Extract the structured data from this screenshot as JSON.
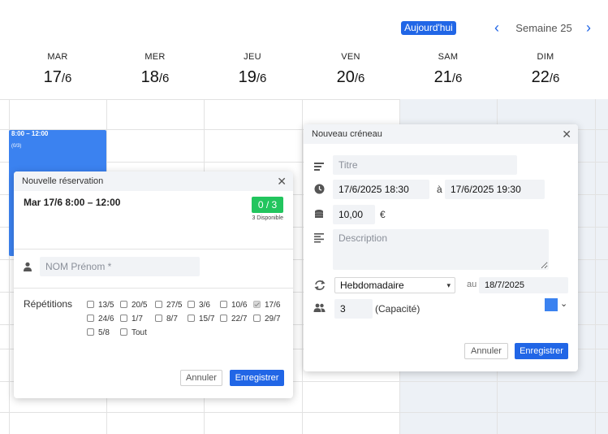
{
  "toolbar": {
    "today_label": "Aujourd'hui",
    "week_label": "Semaine 25"
  },
  "days": [
    {
      "name": "MAR",
      "num": "17",
      "month": "/6"
    },
    {
      "name": "MER",
      "num": "18",
      "month": "/6"
    },
    {
      "name": "JEU",
      "num": "19",
      "month": "/6"
    },
    {
      "name": "VEN",
      "num": "20",
      "month": "/6"
    },
    {
      "name": "SAM",
      "num": "21",
      "month": "/6"
    },
    {
      "name": "DIM",
      "num": "22",
      "month": "/6"
    }
  ],
  "event": {
    "time": "8:00 – 12:00",
    "capacity": "(0/3)",
    "color": "#3b82f0"
  },
  "reservation": {
    "title": "Nouvelle réservation",
    "slot": "Mar 17/6  8:00 – 12:00",
    "count": "0 / 3",
    "available": "3 Disponible",
    "name_placeholder": "NOM Prénom *",
    "repetitions_label": "Répétitions",
    "repetitions": [
      {
        "label": "13/5",
        "checked": false
      },
      {
        "label": "20/5",
        "checked": false
      },
      {
        "label": "27/5",
        "checked": false
      },
      {
        "label": "3/6",
        "checked": false
      },
      {
        "label": "10/6",
        "checked": false
      },
      {
        "label": "17/6",
        "checked": true
      },
      {
        "label": "24/6",
        "checked": false
      },
      {
        "label": "1/7",
        "checked": false
      },
      {
        "label": "8/7",
        "checked": false
      },
      {
        "label": "15/7",
        "checked": false
      },
      {
        "label": "22/7",
        "checked": false
      },
      {
        "label": "29/7",
        "checked": false
      },
      {
        "label": "5/8",
        "checked": false
      },
      {
        "label": "Tout",
        "checked": false
      }
    ],
    "cancel_label": "Annuler",
    "save_label": "Enregistrer"
  },
  "slot_dialog": {
    "title": "Nouveau créneau",
    "title_placeholder": "Titre",
    "start": "17/6/2025  18:30",
    "to_label": "à",
    "end": "17/6/2025  19:30",
    "price": "10,00",
    "currency": "€",
    "description_placeholder": "Description",
    "recurrence": "Hebdomadaire",
    "until_label": "au",
    "until": "18/7/2025",
    "capacity": "3",
    "capacity_label": "(Capacité)",
    "color": "#3b82f0",
    "cancel_label": "Annuler",
    "save_label": "Enregistrer"
  }
}
